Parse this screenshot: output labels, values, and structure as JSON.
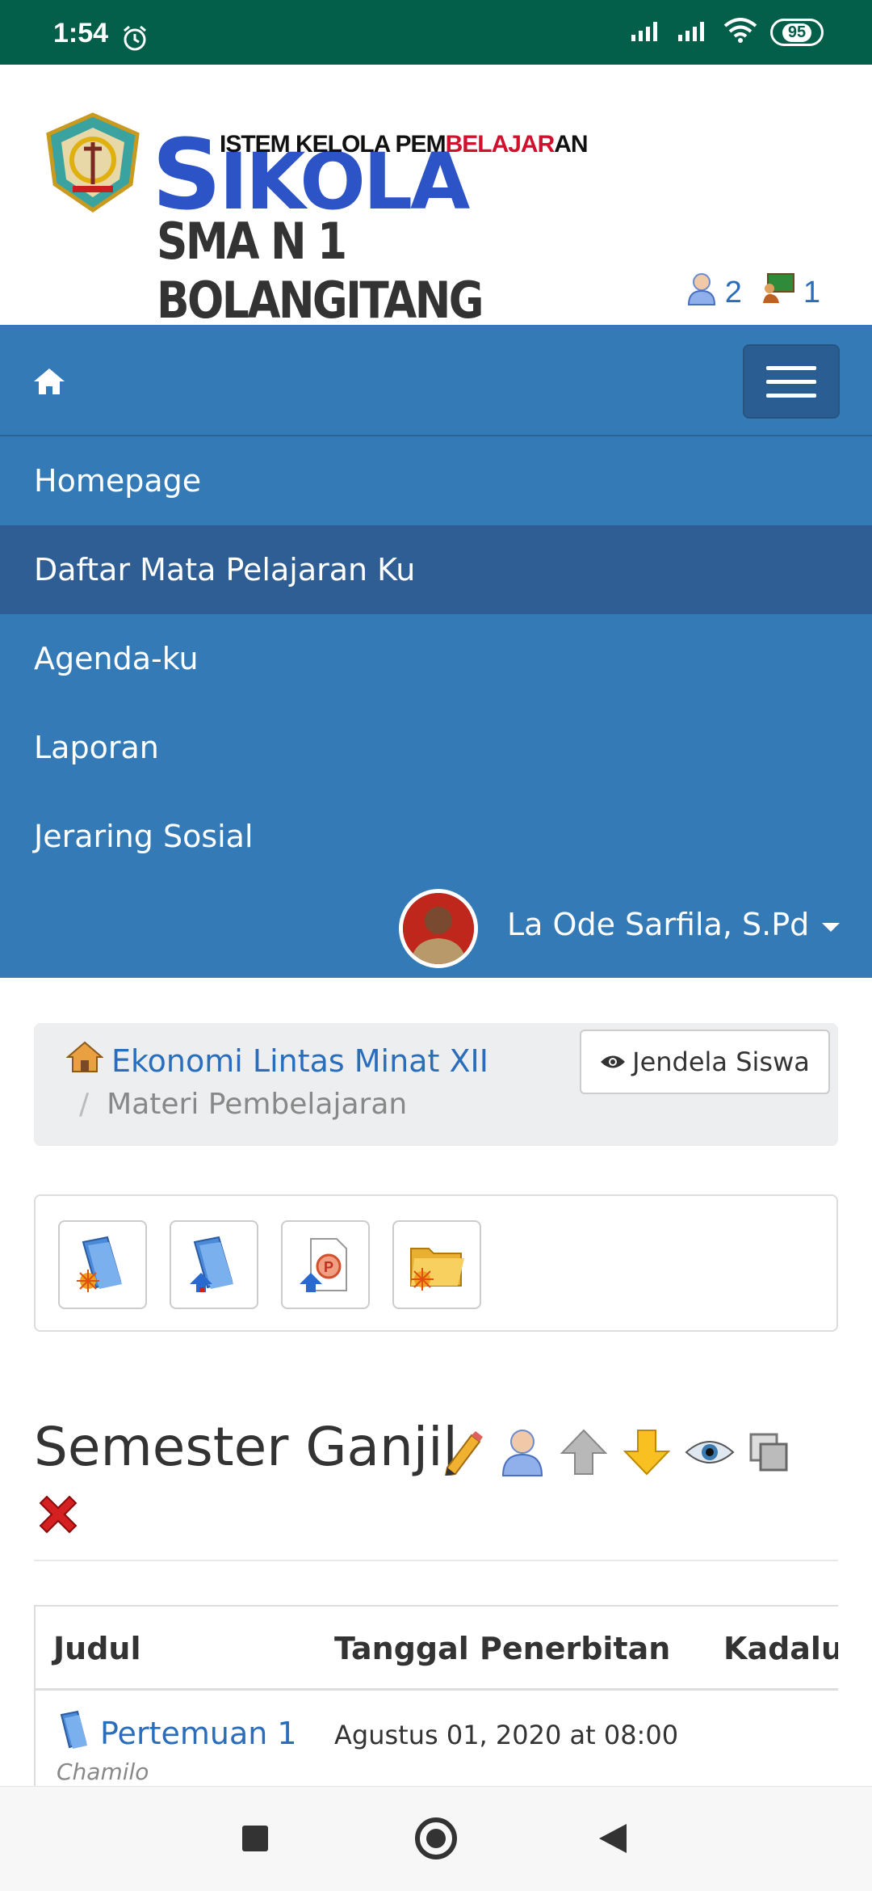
{
  "status_bar": {
    "time": "1:54",
    "battery": "95",
    "icons": [
      "alarm-icon",
      "signal-icon",
      "signal-icon",
      "wifi-icon",
      "battery-icon"
    ]
  },
  "header": {
    "logo_line1_a": "ISTEM KELOLA PEM",
    "logo_line1_b": "BELAJAR",
    "logo_line1_c": "AN",
    "logo_big_s": "S",
    "logo_big_rest": "IKOLA",
    "logo_line3": "SMA N 1 BOLANGITANG",
    "online_users": "2",
    "online_classes": "1"
  },
  "nav": {
    "items": [
      {
        "label": "Homepage"
      },
      {
        "label": "Daftar Mata Pelajaran Ku"
      },
      {
        "label": "Agenda-ku"
      },
      {
        "label": "Laporan"
      },
      {
        "label": "Jeraring Sosial"
      }
    ],
    "user_name": "La Ode Sarfila, S.Pd"
  },
  "breadcrumb": {
    "course": "Ekonomi Lintas Minat XII",
    "separator": "/",
    "current": "Materi Pembelajaran",
    "student_view": "Jendela Siswa"
  },
  "section": {
    "title": "Semester Ganjil"
  },
  "table": {
    "headers": [
      "Judul",
      "Tanggal Penerbitan",
      "Kadalua"
    ],
    "rows": [
      {
        "title": "Pertemuan 1",
        "author": "Chamilo",
        "date": "Agustus 01, 2020 at 08:00"
      }
    ]
  },
  "colors": {
    "status_bar": "#035e4a",
    "navbar": "#337ab7",
    "navbar_active": "#2e5e93",
    "link": "#2a6ebb"
  }
}
